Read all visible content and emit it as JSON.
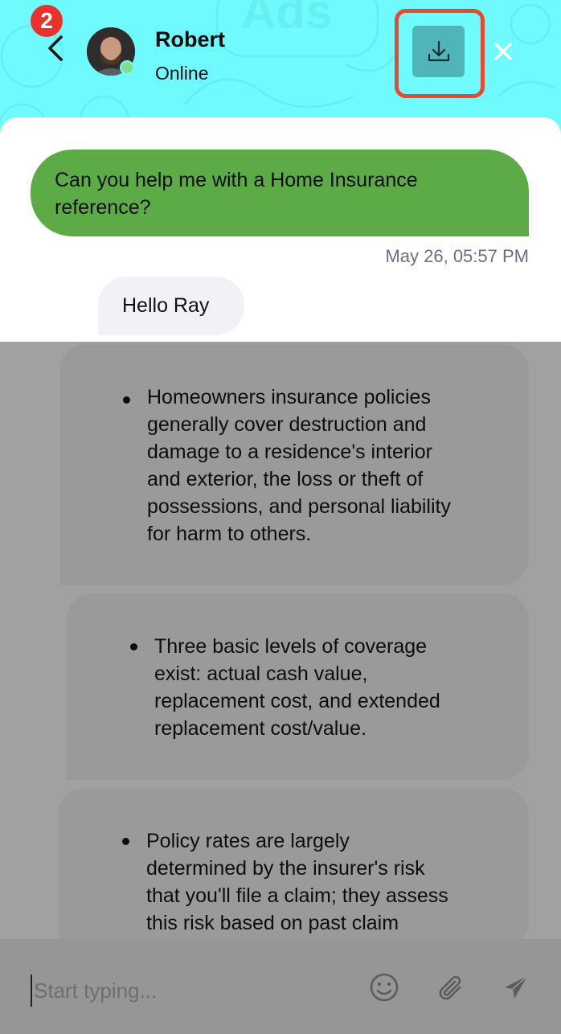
{
  "header": {
    "notification_count": "2",
    "contact": {
      "name": "Robert",
      "status": "Online"
    }
  },
  "messages": [
    {
      "direction": "outgoing",
      "text": "Can you help me with a Home Insurance reference?",
      "timestamp": "May 26, 05:57 PM"
    },
    {
      "direction": "incoming",
      "text": "Hello Ray"
    }
  ],
  "cards": [
    {
      "lines": [
        "Homeowners insurance policies",
        "generally cover destruction and",
        "damage to a residence's interior",
        "and exterior, the loss or theft of",
        "possessions, and personal liability",
        "for harm to others."
      ]
    },
    {
      "lines": [
        "Three basic levels of coverage",
        "exist: actual cash value,",
        "replacement cost, and extended",
        "replacement cost/value."
      ]
    },
    {
      "lines": [
        "Policy rates are largely",
        "determined by the insurer's risk",
        "that you'll file a claim; they assess",
        "this risk based on past claim"
      ]
    }
  ],
  "composer": {
    "placeholder": "Start typing..."
  },
  "colors": {
    "header_bg": "#6ffbfd",
    "outgoing_bubble": "#5dab47",
    "download_highlight": "#e84a2f",
    "badge": "#e8322c"
  },
  "icons": [
    "back-icon",
    "download-icon",
    "close-icon",
    "emoji-icon",
    "attachment-icon",
    "send-icon"
  ]
}
